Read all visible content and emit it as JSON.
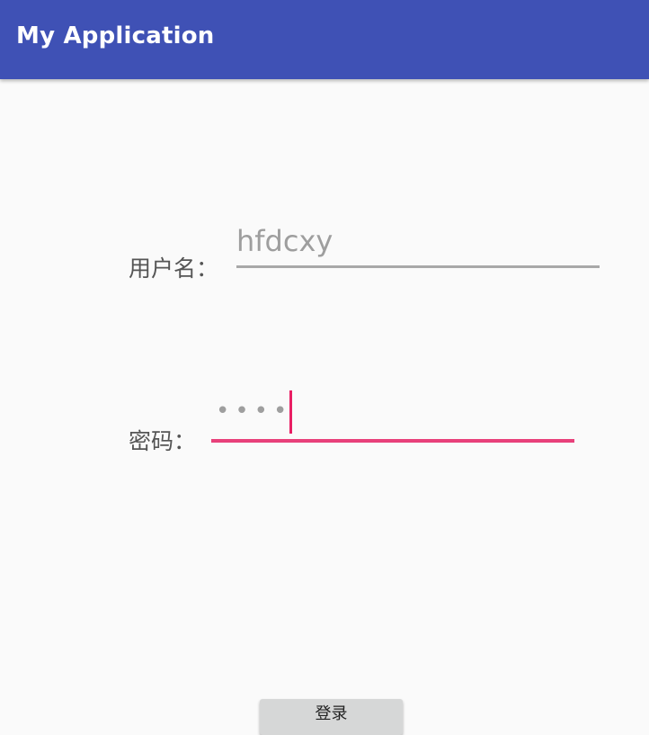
{
  "app_bar": {
    "title": "My Application",
    "background": "#3f51b5"
  },
  "form": {
    "username": {
      "label": "用户名：",
      "value": "hfdcxy"
    },
    "password": {
      "label": "密码：",
      "masked_value": "••••",
      "focused": true,
      "accent_color": "#e91e63"
    },
    "login_button": {
      "label": "登录"
    }
  }
}
